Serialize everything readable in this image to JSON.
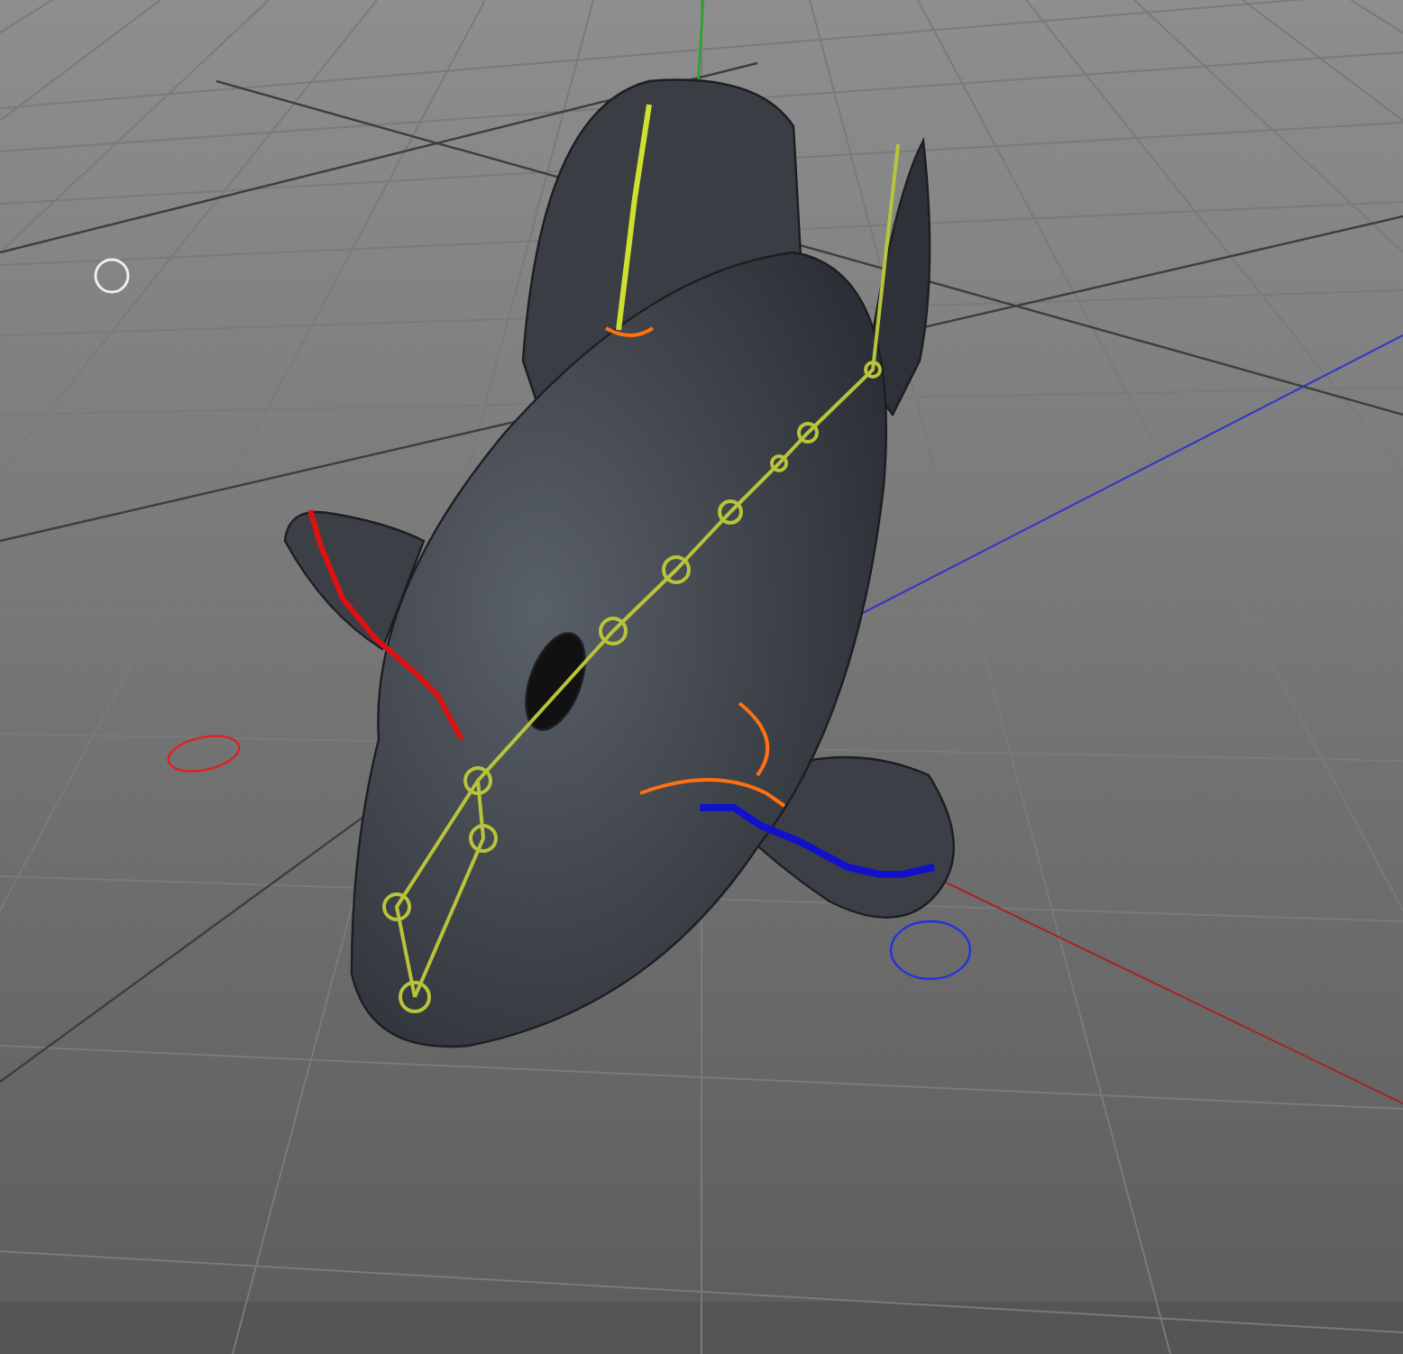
{
  "viewport": {
    "grid": true,
    "axes": true,
    "rig": true
  }
}
